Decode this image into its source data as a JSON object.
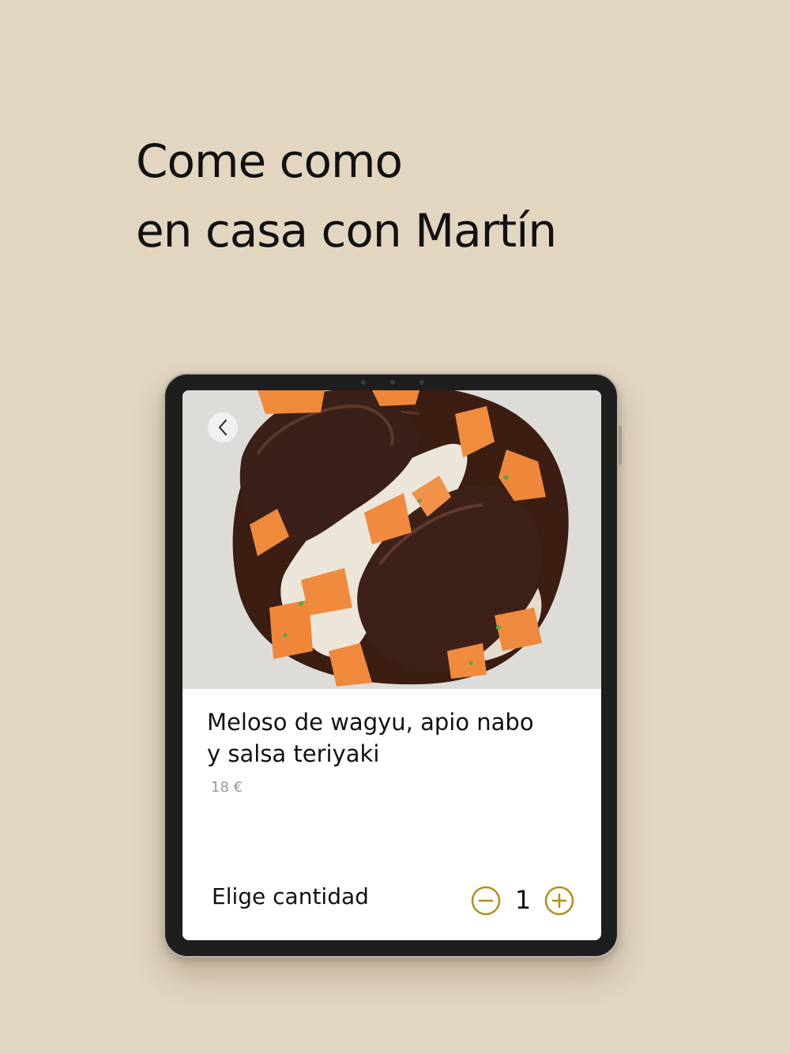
{
  "headline": {
    "line1": "Come como",
    "line2": "en casa con Martín"
  },
  "dish": {
    "title": "Meloso de wagyu, apio nabo y salsa teriyaki",
    "price": "18 €",
    "image_subject": "wagyu-stew-with-carrots-photo"
  },
  "quantity": {
    "label": "Elige cantidad",
    "value": "1",
    "minus_icon": "minus-circle-icon",
    "plus_icon": "plus-circle-icon"
  },
  "navigation": {
    "back_icon": "chevron-left-icon"
  },
  "colors": {
    "background": "#e2d6c1",
    "accent_gold": "#b38d1e",
    "text": "#111111",
    "price_grey": "#9a9a9a"
  }
}
